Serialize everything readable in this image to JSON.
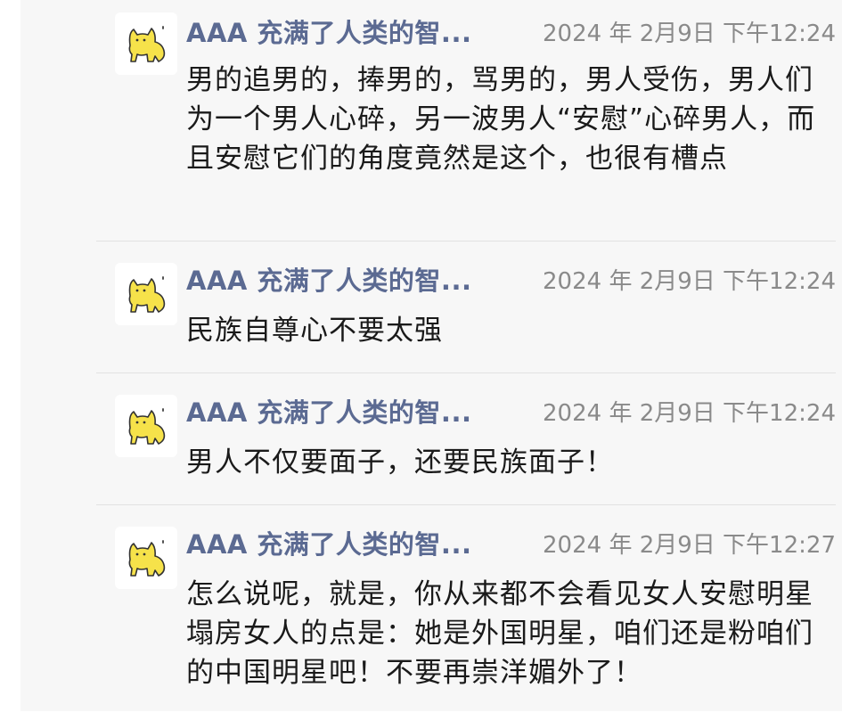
{
  "colors": {
    "nickname": "#5b6a92",
    "timestamp": "#8a8a8a",
    "body_text": "#1a1a1a",
    "panel_background": "#f7f7f7",
    "avatar_fill": "#f6e24a"
  },
  "icons": {
    "comment": "comment-icon",
    "avatar": "yellow-cat-avatar"
  },
  "replies": [
    {
      "nickname": "AAA 充满了人类的智...",
      "timestamp": "2024 年 2月9日 下午12:24",
      "content": "男的追男的，捧男的，骂男的，男人受伤，男人们为一个男人心碎，另一波男人“安慰”心碎男人，而且安慰它们的角度竟然是这个，也很有槽点"
    },
    {
      "nickname": "AAA 充满了人类的智...",
      "timestamp": "2024 年 2月9日 下午12:24",
      "content": "民族自尊心不要太强"
    },
    {
      "nickname": "AAA 充满了人类的智...",
      "timestamp": "2024 年 2月9日 下午12:24",
      "content": "男人不仅要面子，还要民族面子！"
    },
    {
      "nickname": "AAA 充满了人类的智...",
      "timestamp": "2024 年 2月9日 下午12:27",
      "content": "怎么说呢，就是，你从来都不会看见女人安慰明星塌房女人的点是：她是外国明星，咱们还是粉咱们的中国明星吧！不要再崇洋媚外了！"
    }
  ]
}
